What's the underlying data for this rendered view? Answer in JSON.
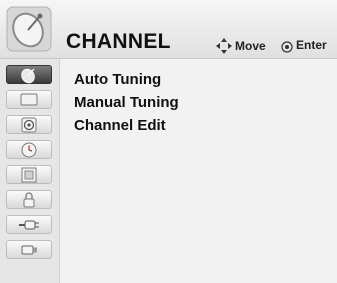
{
  "header": {
    "title": "CHANNEL",
    "move_label": "Move",
    "enter_label": "Enter",
    "icon": "satellite-dish-icon"
  },
  "sidebar": {
    "active_index": 0,
    "items": [
      {
        "icon": "satellite-dish-icon"
      },
      {
        "icon": "tv-screen-icon"
      },
      {
        "icon": "speaker-icon"
      },
      {
        "icon": "clock-icon"
      },
      {
        "icon": "film-frame-icon"
      },
      {
        "icon": "padlock-icon"
      },
      {
        "icon": "av-input-plug-icon"
      },
      {
        "icon": "usb-icon"
      }
    ]
  },
  "menu": {
    "items": [
      {
        "label": "Auto Tuning"
      },
      {
        "label": "Manual Tuning"
      },
      {
        "label": "Channel Edit"
      }
    ]
  }
}
